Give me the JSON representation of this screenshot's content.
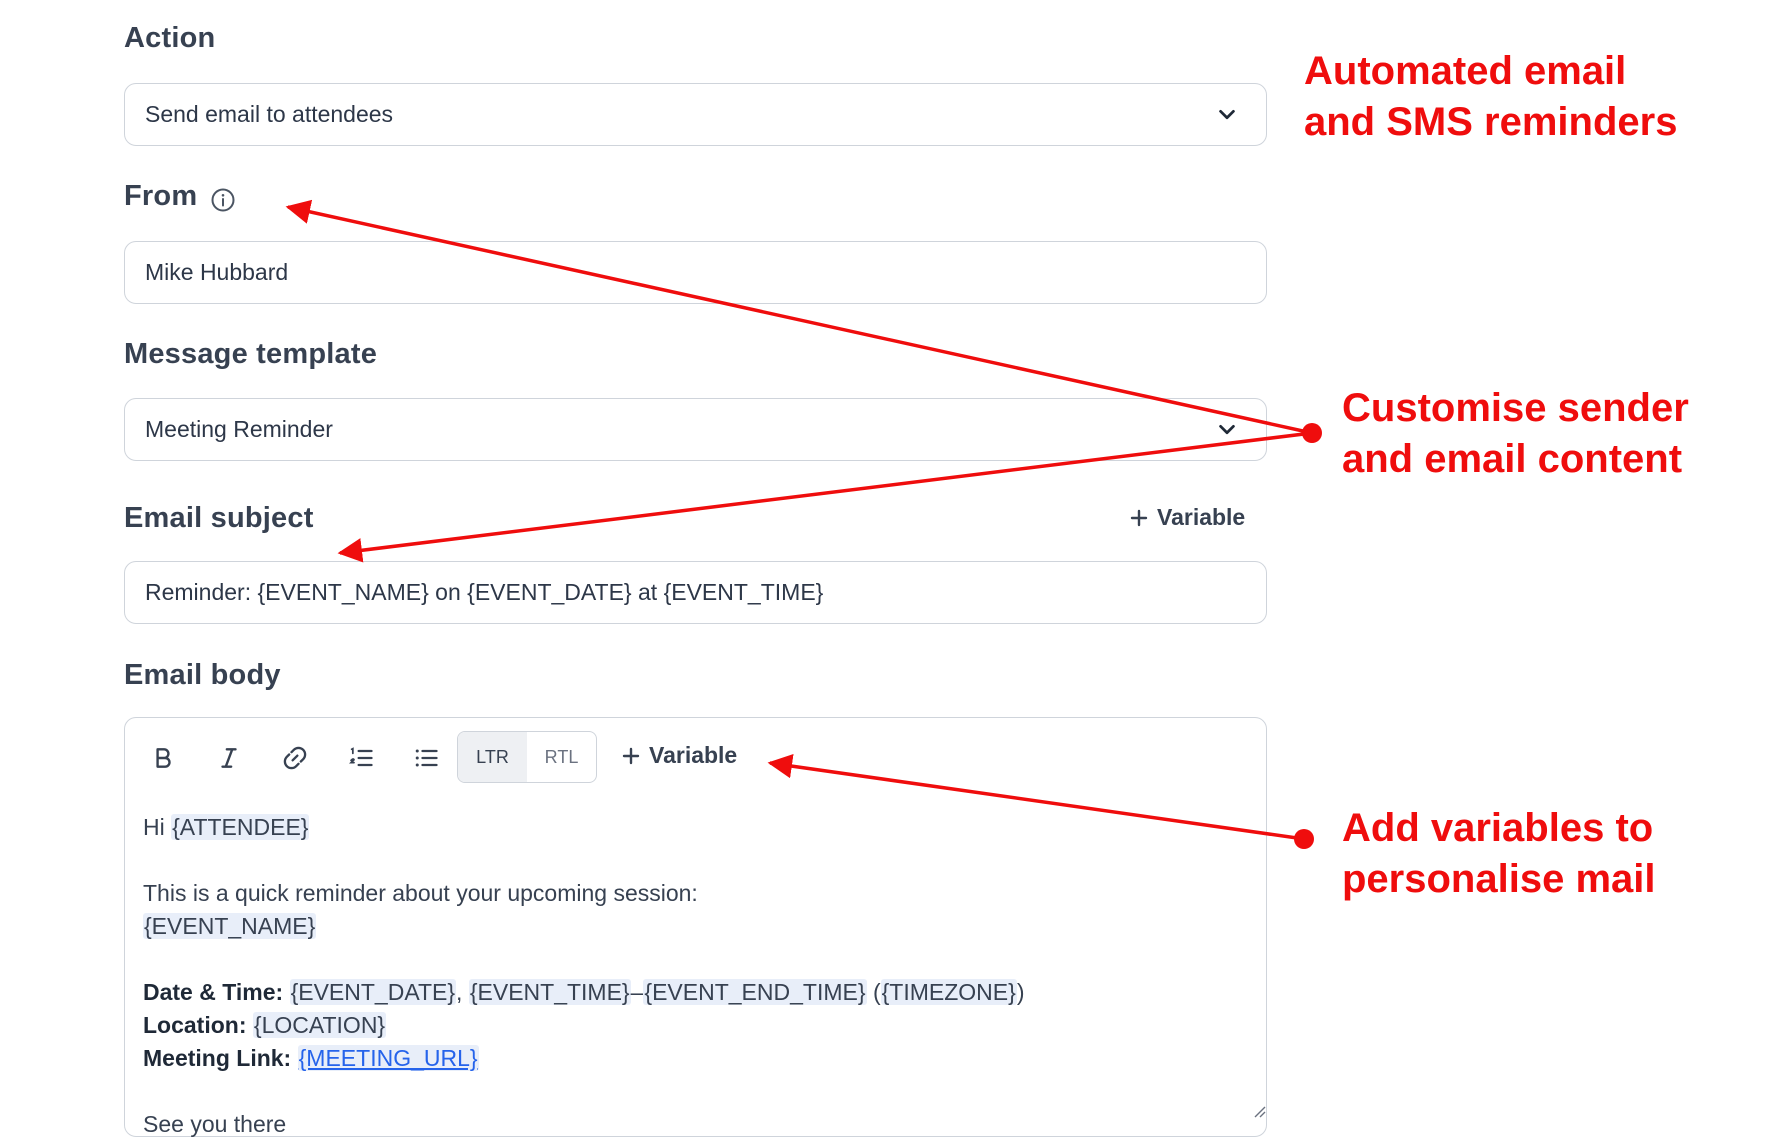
{
  "form": {
    "action": {
      "label": "Action",
      "value": "Send email to attendees"
    },
    "from": {
      "label": "From",
      "value": "Mike Hubbard"
    },
    "template": {
      "label": "Message template",
      "value": "Meeting Reminder"
    },
    "subject": {
      "label": "Email subject",
      "variable_button": "Variable",
      "value": "Reminder: {EVENT_NAME} on {EVENT_DATE} at {EVENT_TIME}"
    },
    "body": {
      "label": "Email body",
      "toolbar": {
        "ltr": "LTR",
        "rtl": "RTL",
        "variable_button": "Variable"
      },
      "greeting": "Hi",
      "attendee": "{ATTENDEE}",
      "intro": "This is a quick reminder about your upcoming session:",
      "event_name": "{EVENT_NAME}",
      "datetime_label": "Date & Time:",
      "event_date": "{EVENT_DATE}",
      "comma": ",",
      "event_time": "{EVENT_TIME}",
      "dash": "–",
      "event_end_time": "{EVENT_END_TIME}",
      "open_paren": "(",
      "timezone": "{TIMEZONE}",
      "close_paren": ")",
      "location_label": "Location:",
      "location": "{LOCATION}",
      "link_label": "Meeting Link:",
      "meeting_url": "{MEETING_URL}",
      "closing_partial": "See you there"
    }
  },
  "annotations": {
    "top_line1": "Automated email",
    "top_line2": "and SMS reminders",
    "mid_line1": "Customise sender",
    "mid_line2": "and email content",
    "bottom_line1": "Add variables to",
    "bottom_line2": "personalise mail"
  },
  "colors": {
    "annotation": "#ef0d0d",
    "border": "#cfd4db",
    "variable_chip": "#e8eef9",
    "link": "#2563eb"
  },
  "icons": [
    "chevron-down-icon",
    "info-icon",
    "plus-icon",
    "bold-icon",
    "italic-icon",
    "link-icon",
    "ordered-list-icon",
    "bullet-list-icon",
    "resize-handle-icon"
  ]
}
